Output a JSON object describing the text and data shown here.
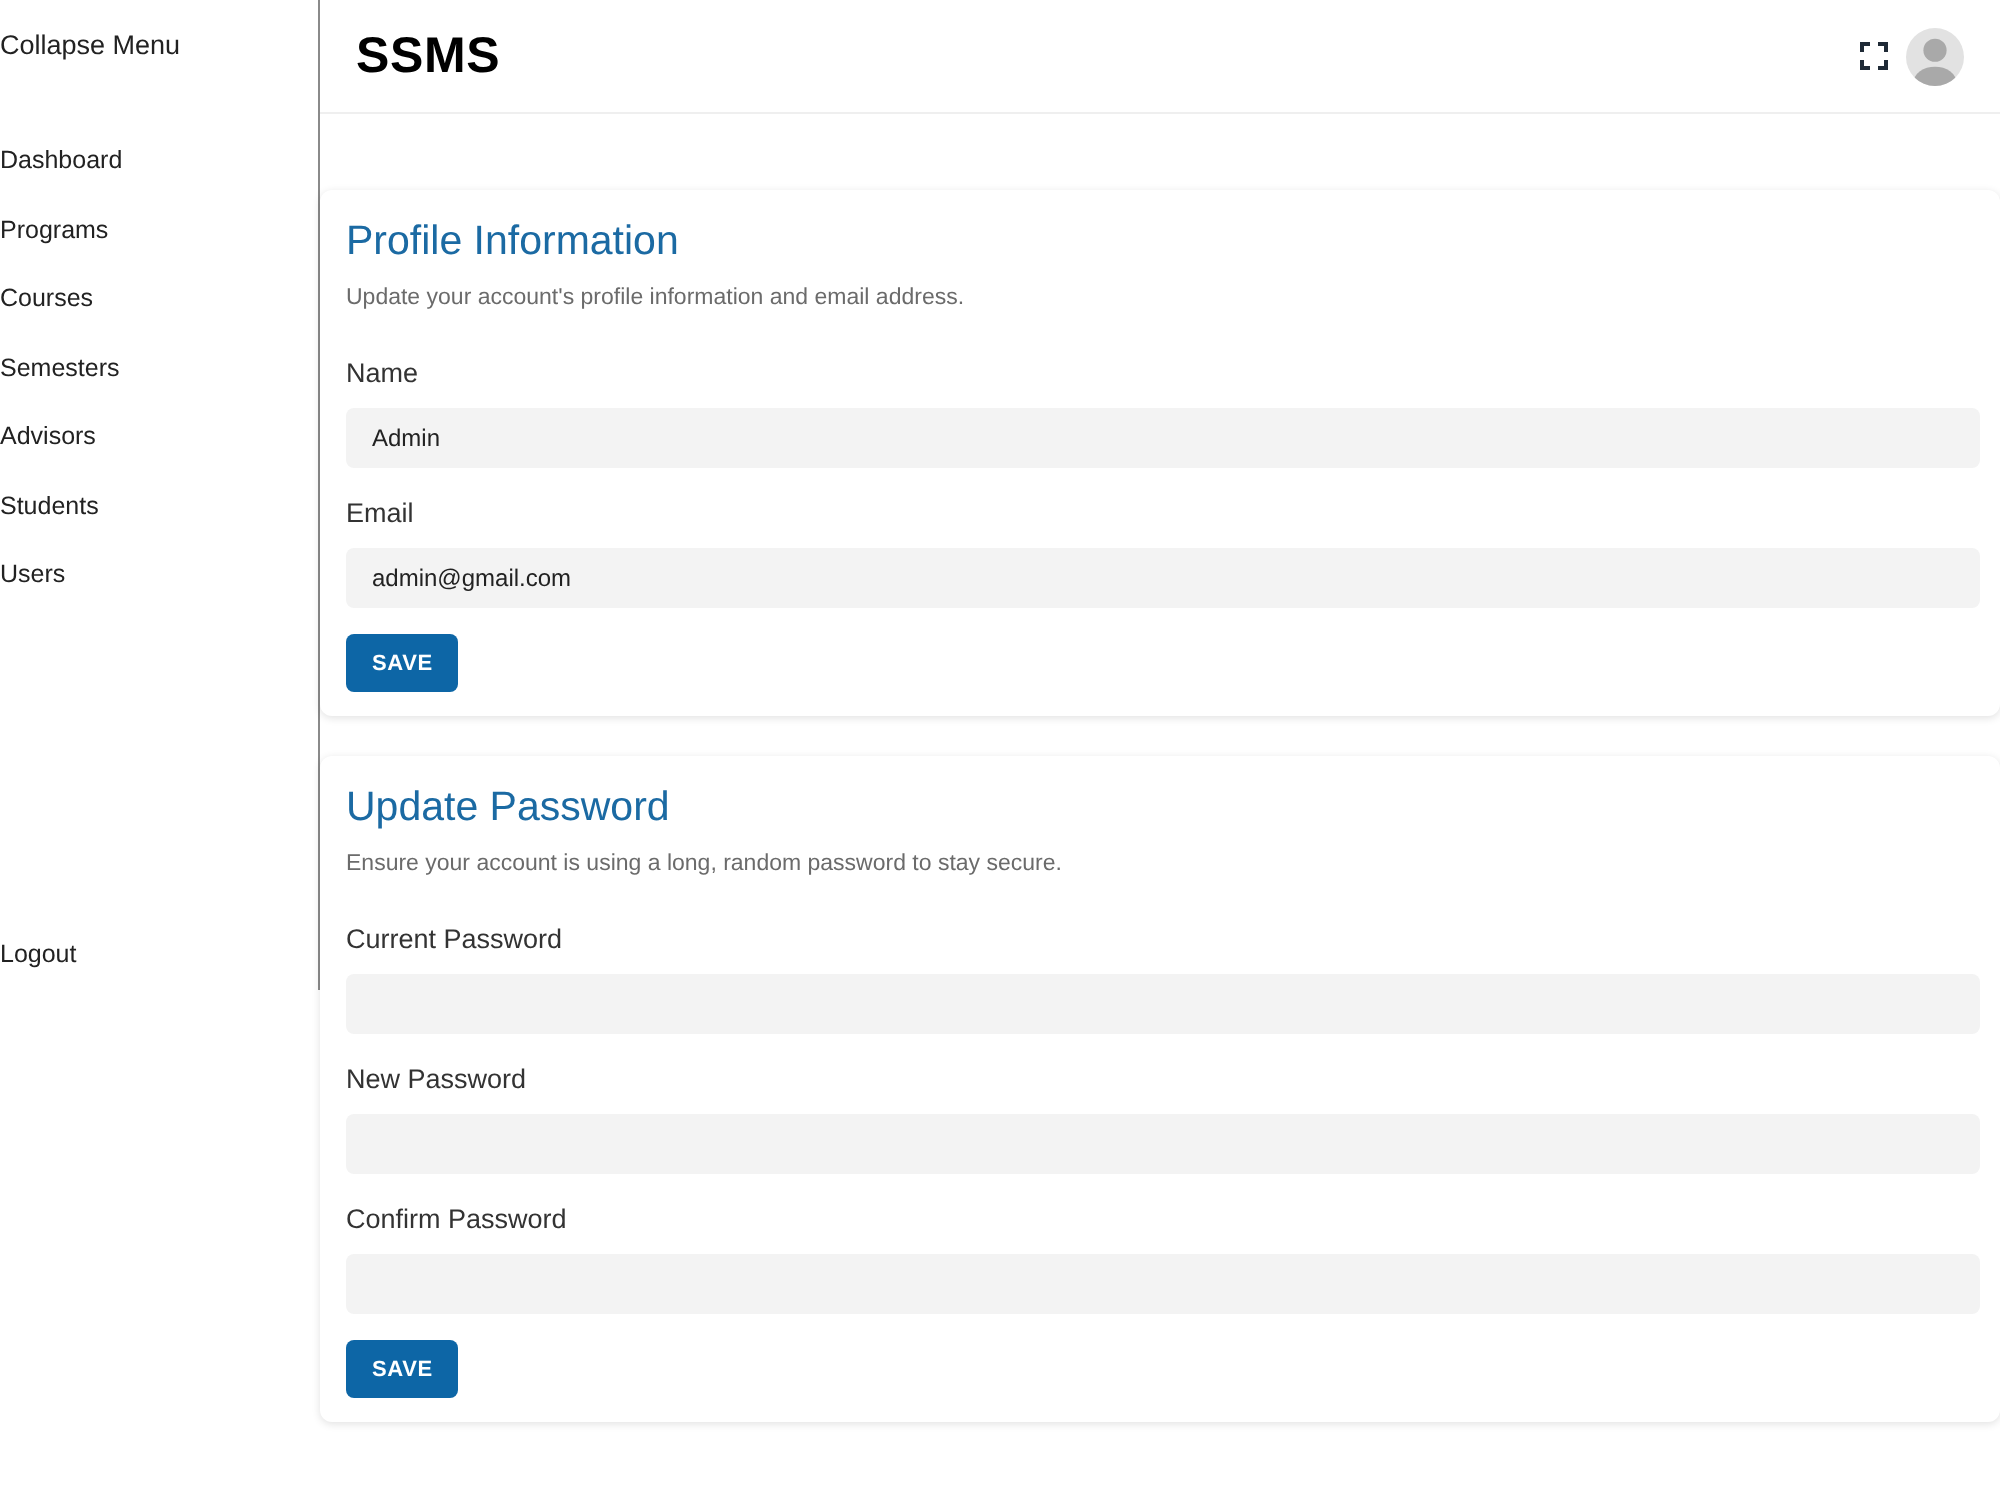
{
  "sidebar": {
    "collapse_label": "Collapse Menu",
    "items": [
      {
        "label": "Dashboard"
      },
      {
        "label": "Programs"
      },
      {
        "label": "Courses"
      },
      {
        "label": "Semesters"
      },
      {
        "label": "Advisors"
      },
      {
        "label": "Students"
      },
      {
        "label": "Users"
      }
    ],
    "logout": "Logout"
  },
  "header": {
    "title": "SSMS"
  },
  "sections": [
    {
      "title": "Profile Information",
      "description": "Update your account's profile information and email address.",
      "fields": [
        {
          "label": "Name",
          "value": "Admin"
        },
        {
          "label": "Email",
          "value": "admin@gmail.com"
        }
      ],
      "button": "SAVE"
    },
    {
      "title": "Update Password",
      "description": "Ensure your account is using a long, random password to stay secure.",
      "fields": [
        {
          "label": "Current Password"
        },
        {
          "label": "New Password"
        },
        {
          "label": "Confirm Password"
        }
      ],
      "button": "SAVE"
    }
  ]
}
